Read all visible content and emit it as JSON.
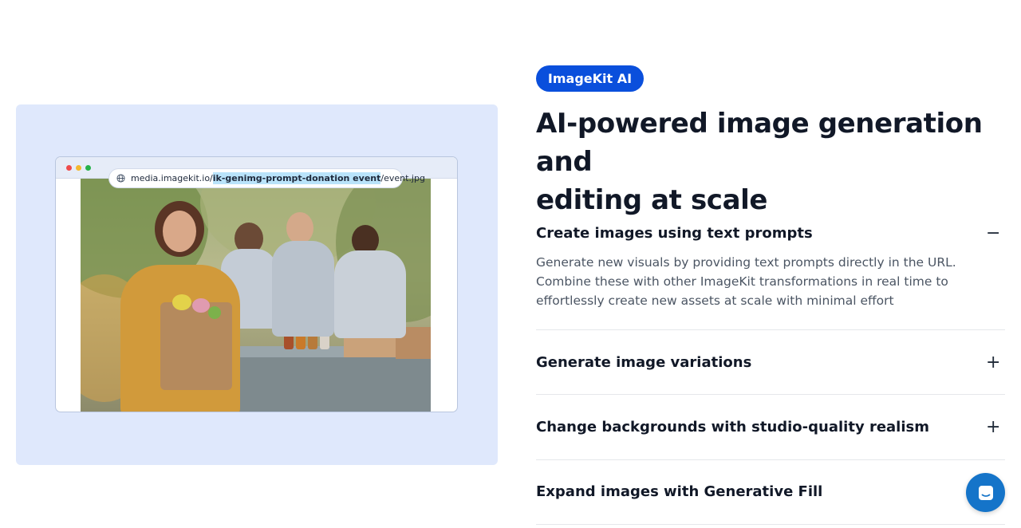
{
  "illustration": {
    "url_prefix": "media.imagekit.io/",
    "url_highlight": "ik-genimg-prompt-donation event",
    "url_suffix": "/event.jpg"
  },
  "badge": {
    "label": "ImageKit AI"
  },
  "headline": {
    "line1": "AI-powered image generation and",
    "line2": "editing at scale"
  },
  "accordion": {
    "items": [
      {
        "title": "Create images using text prompts",
        "toggle": "−",
        "expanded": true,
        "description": "Generate new visuals by providing text prompts directly in the URL. Combine these with other ImageKit transformations in real time to effortlessly create new assets at scale with minimal effort"
      },
      {
        "title": "Generate image variations",
        "toggle": "+",
        "expanded": false
      },
      {
        "title": "Change backgrounds with studio-quality realism",
        "toggle": "+",
        "expanded": false
      },
      {
        "title": "Expand images with Generative Fill",
        "toggle": "+",
        "expanded": false
      }
    ]
  },
  "colors": {
    "accent": "#0a4fdc",
    "panel_bg": "#dfe8fc",
    "chat_button": "#1574c9"
  },
  "icons": {
    "globe": "globe-icon",
    "chat": "chat-icon"
  }
}
